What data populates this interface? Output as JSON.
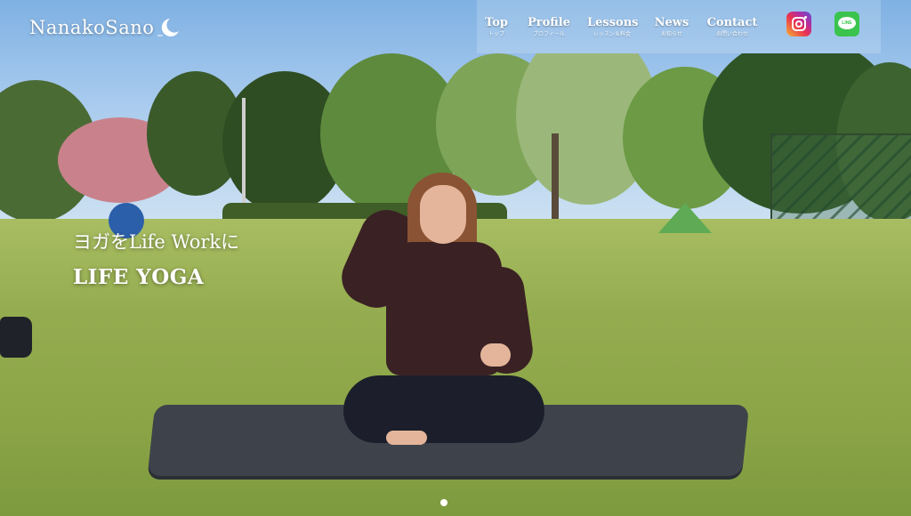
{
  "site": {
    "logo_text": "NanakoSano"
  },
  "nav": {
    "items": [
      {
        "label": "Top",
        "sub": "トップ"
      },
      {
        "label": "Profile",
        "sub": "プロフィール"
      },
      {
        "label": "Lessons",
        "sub": "レッスン＆料金"
      },
      {
        "label": "News",
        "sub": "お知らせ"
      },
      {
        "label": "Contact",
        "sub": "お問い合わせ"
      }
    ]
  },
  "social": {
    "instagram_icon": "instagram-icon",
    "line_icon": "line-icon",
    "line_text": "LINE"
  },
  "hero": {
    "tagline": "ヨガをLife Workに",
    "title": "LIFE YOGA"
  },
  "colors": {
    "accent_white": "#ffffff",
    "line_green": "#3ac44e"
  }
}
